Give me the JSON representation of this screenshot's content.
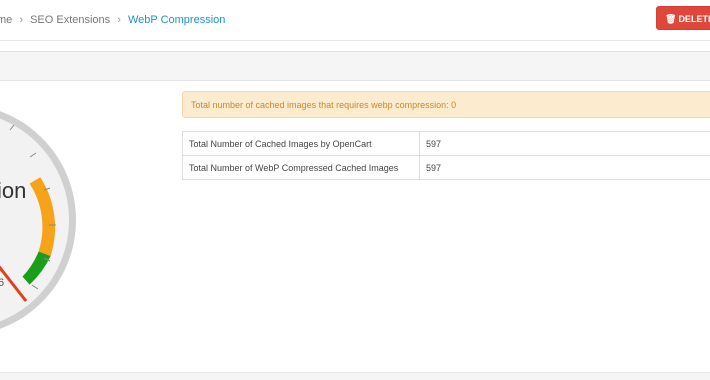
{
  "breadcrumb": {
    "home": "me",
    "extensions": "SEO Extensions",
    "current": "WebP Compression"
  },
  "toolbar": {
    "delete_label": "DELETE I"
  },
  "alert": {
    "text": "Total number of cached images that requires webp compression: 0"
  },
  "stats": {
    "rows": [
      {
        "label": "Total Number of Cached Images by OpenCart",
        "value": "597"
      },
      {
        "label": "Total Number of WebP Compressed Cached Images",
        "value": "597"
      }
    ]
  },
  "gauge": {
    "label_fragment": "ion",
    "value_fragment": "6",
    "colors": {
      "ring": "#c8c8c8",
      "face": "#f2f2f2",
      "orange": "#f7a21b",
      "green": "#1a9e1a",
      "needle": "#e2401c"
    }
  },
  "colors": {
    "accent": "#1e91cf",
    "danger": "#e0473b",
    "warning_bg": "#fcebcf",
    "warning_text": "#c78a2b"
  }
}
